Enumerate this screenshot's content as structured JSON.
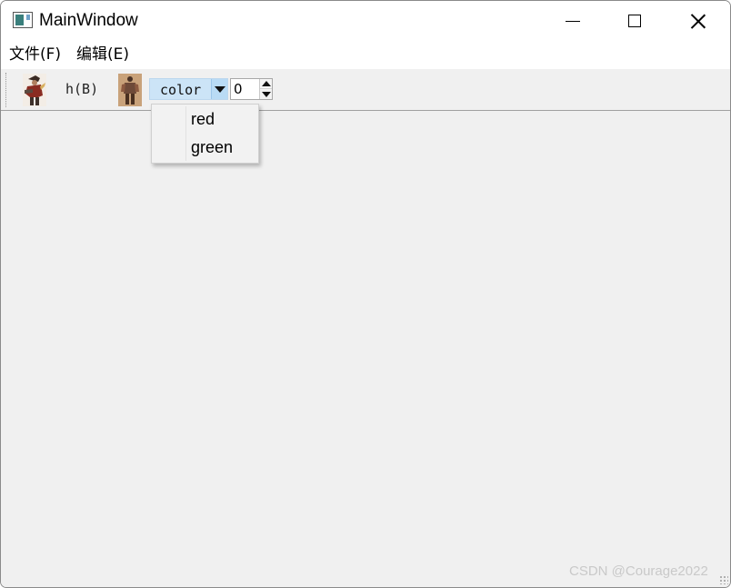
{
  "window": {
    "title": "MainWindow"
  },
  "menubar": {
    "items": [
      "文件(F)",
      "编辑(E)"
    ]
  },
  "toolbar": {
    "action_label": "h(B)",
    "combo": {
      "value": "color",
      "options": [
        "red",
        "green"
      ]
    },
    "spinbox": {
      "value": "0"
    }
  },
  "watermark": "CSDN @Courage2022",
  "colors": {
    "combo_highlight": "#cce4f7",
    "window_bg": "#f0f0f0"
  },
  "icons": [
    "app-window-icon",
    "character-image-1",
    "character-image-2",
    "minimize-icon",
    "maximize-icon",
    "close-icon",
    "dropdown-arrow-icon",
    "spin-up-icon",
    "spin-down-icon"
  ]
}
